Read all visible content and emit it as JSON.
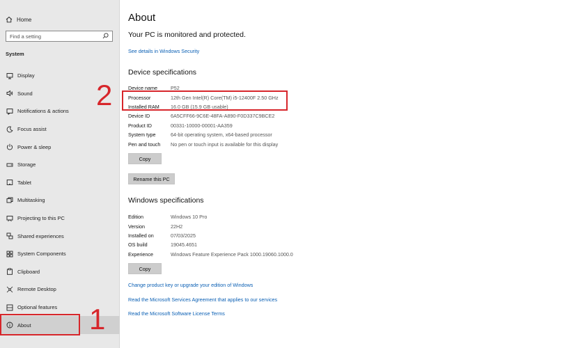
{
  "sidebar": {
    "home_label": "Home",
    "search_placeholder": "Find a setting",
    "section_label": "System",
    "items": [
      {
        "label": "Display",
        "icon": "display-icon"
      },
      {
        "label": "Sound",
        "icon": "sound-icon"
      },
      {
        "label": "Notifications & actions",
        "icon": "notifications-icon"
      },
      {
        "label": "Focus assist",
        "icon": "moon-icon"
      },
      {
        "label": "Power & sleep",
        "icon": "power-icon"
      },
      {
        "label": "Storage",
        "icon": "storage-icon"
      },
      {
        "label": "Tablet",
        "icon": "tablet-icon"
      },
      {
        "label": "Multitasking",
        "icon": "multitasking-icon"
      },
      {
        "label": "Projecting to this PC",
        "icon": "projecting-icon"
      },
      {
        "label": "Shared experiences",
        "icon": "shared-icon"
      },
      {
        "label": "System Components",
        "icon": "components-icon"
      },
      {
        "label": "Clipboard",
        "icon": "clipboard-icon"
      },
      {
        "label": "Remote Desktop",
        "icon": "remote-desktop-icon"
      },
      {
        "label": "Optional features",
        "icon": "optional-features-icon"
      },
      {
        "label": "About",
        "icon": "info-icon"
      }
    ]
  },
  "annotations": {
    "one": "1",
    "two": "2",
    "color": "#d7262b"
  },
  "main": {
    "title": "About",
    "protection_text": "Your PC is monitored and protected.",
    "security_link": "See details in Windows Security",
    "device_heading": "Device specifications",
    "device_specs": [
      {
        "key": "Device name",
        "value": "P52"
      },
      {
        "key": "Processor",
        "value": "12th Gen Intel(R) Core(TM) i5-12400F   2.50 GHz"
      },
      {
        "key": "Installed RAM",
        "value": "16.0 GB (15.9 GB usable)"
      },
      {
        "key": "Device ID",
        "value": "6A5CFF66-9C6E-48FA-A890-F0D337C9BCE2"
      },
      {
        "key": "Product ID",
        "value": "00331-10000-00001-AA359"
      },
      {
        "key": "System type",
        "value": "64-bit operating system, x64-based processor"
      },
      {
        "key": "Pen and touch",
        "value": "No pen or touch input is available for this display"
      }
    ],
    "copy_label": "Copy",
    "rename_label": "Rename this PC",
    "windows_heading": "Windows specifications",
    "windows_specs": [
      {
        "key": "Edition",
        "value": "Windows 10 Pro"
      },
      {
        "key": "Version",
        "value": "22H2"
      },
      {
        "key": "Installed on",
        "value": "07/03/2025"
      },
      {
        "key": "OS build",
        "value": "19045.4651"
      },
      {
        "key": "Experience",
        "value": "Windows Feature Experience Pack 1000.19060.1000.0"
      }
    ],
    "copy2_label": "Copy",
    "links": [
      "Change product key or upgrade your edition of Windows",
      "Read the Microsoft Services Agreement that applies to our services",
      "Read the Microsoft Software License Terms"
    ]
  }
}
